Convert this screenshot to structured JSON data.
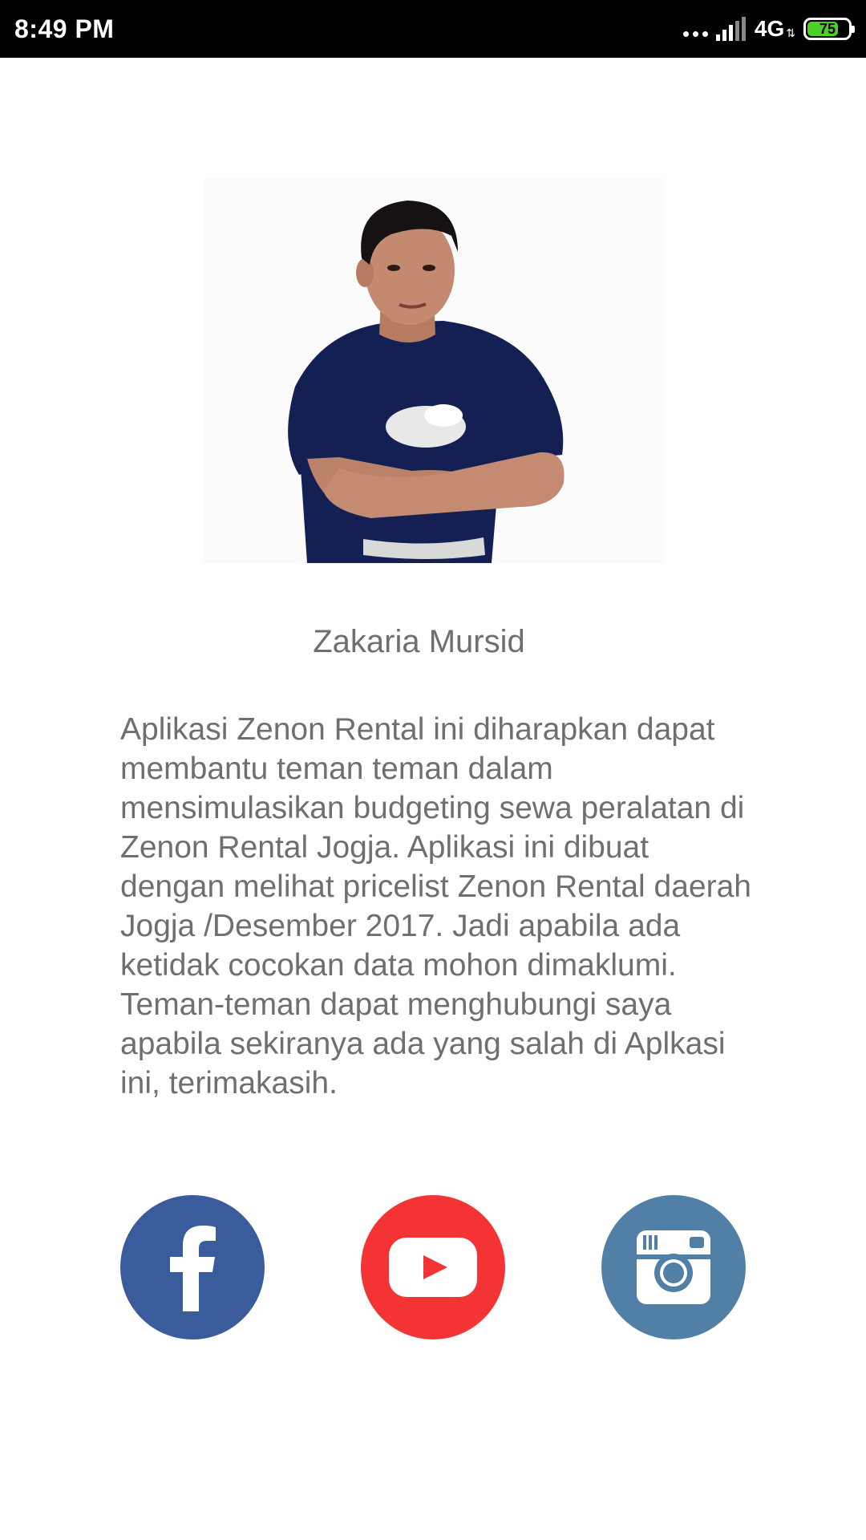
{
  "status_bar": {
    "time": "8:49 PM",
    "network": "4G",
    "battery_level": "75",
    "battery_fraction": 0.75
  },
  "profile": {
    "name": "Zakaria Mursid",
    "description": "Aplikasi Zenon Rental ini diharapkan dapat membantu teman teman dalam mensimulasikan budgeting sewa peralatan di Zenon Rental Jogja. Aplikasi ini dibuat dengan melihat pricelist Zenon Rental daerah Jogja /Desember 2017. Jadi apabila ada ketidak cocokan data mohon dimaklumi. Teman-teman dapat menghubungi saya apabila sekiranya ada yang salah di Aplkasi ini, terimakasih."
  },
  "social_links": [
    {
      "icon": "facebook-icon",
      "color": "#3a5b9c"
    },
    {
      "icon": "youtube-icon",
      "color": "#f43434"
    },
    {
      "icon": "instagram-icon",
      "color": "#527fa6"
    }
  ],
  "colors": {
    "status_bar_bg": "#000000",
    "text": "#6f6f6f",
    "battery": "#4cd02a"
  }
}
